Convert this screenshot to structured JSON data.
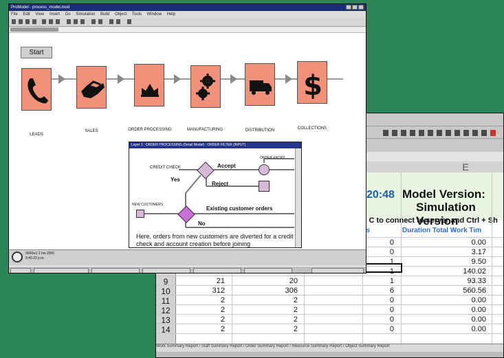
{
  "spreadsheet": {
    "column_label": "E",
    "time": "20:48",
    "model_version_line1": "Model Version:",
    "model_version_line2": "Simulation Version",
    "instruction": "+ C to connect to server and Ctrl + Sh",
    "header_es": "es",
    "header_duration": "Duration Total Work Tim",
    "rows": [
      {
        "num": "",
        "c": "0",
        "d": "0",
        "e": "0.00"
      },
      {
        "num": "",
        "c": "",
        "d": "0",
        "e": "3.17"
      },
      {
        "num": "",
        "c": "",
        "d": "1",
        "e": "9.50"
      },
      {
        "num": "",
        "c": "",
        "d": "1",
        "e": "140.02"
      },
      {
        "num": "9",
        "b": "21",
        "c": "20",
        "d": "1",
        "e": "93.33"
      },
      {
        "num": "10",
        "b": "312",
        "c": "306",
        "d": "6",
        "e": "560.56"
      },
      {
        "num": "11",
        "b": "2",
        "c": "2",
        "d": "0",
        "e": "0.00"
      },
      {
        "num": "12",
        "b": "2",
        "c": "2",
        "d": "0",
        "e": "0.00"
      },
      {
        "num": "13",
        "b": "2",
        "c": "2",
        "d": "0",
        "e": "0.00"
      },
      {
        "num": "14",
        "b": "2",
        "c": "2",
        "d": "0",
        "e": "0.00"
      }
    ],
    "tabs": "Work Summary Report  /  Staff Summary Report  /  Order Summary Report  /  Resource Summary Report  /  Object Summary Report"
  },
  "model": {
    "window_title": "ProModel - process_model.mod",
    "menu": [
      "File",
      "Edit",
      "View",
      "Insert",
      "Go",
      "Simulation",
      "Build",
      "Object",
      "Tools",
      "Window",
      "Help"
    ],
    "start_label": "Start",
    "stages": [
      {
        "label": "LEADS",
        "icon": "phone-icon"
      },
      {
        "label": "SALES",
        "icon": "handshake-icon"
      },
      {
        "label": "ORDER PROCESSING",
        "icon": "crown-icon"
      },
      {
        "label": "MANUFACTURING",
        "icon": "gears-icon"
      },
      {
        "label": "DISTRIBUTION",
        "icon": "truck-icon"
      },
      {
        "label": "COLLECTIONS",
        "icon": "dollar-icon"
      }
    ],
    "clock_line1": "0000w1 2 hw 2000",
    "clock_line2": "9:45:23 p.m."
  },
  "subprocess": {
    "title": "Layer 1 : ORDER PROCESSING (Detail Model) : ORDER FILTER (INPUT)",
    "credit_check": "CREDIT CHECK",
    "order_entry": "ORDER ENTRY",
    "new_customers": "NEW CUSTOMERS",
    "accept": "Accept",
    "reject": "Reject",
    "yes": "Yes",
    "no": "No",
    "existing": "Existing customer orders",
    "description": "Here, orders from new customers are diverted for a credit check and account creation before joining"
  }
}
